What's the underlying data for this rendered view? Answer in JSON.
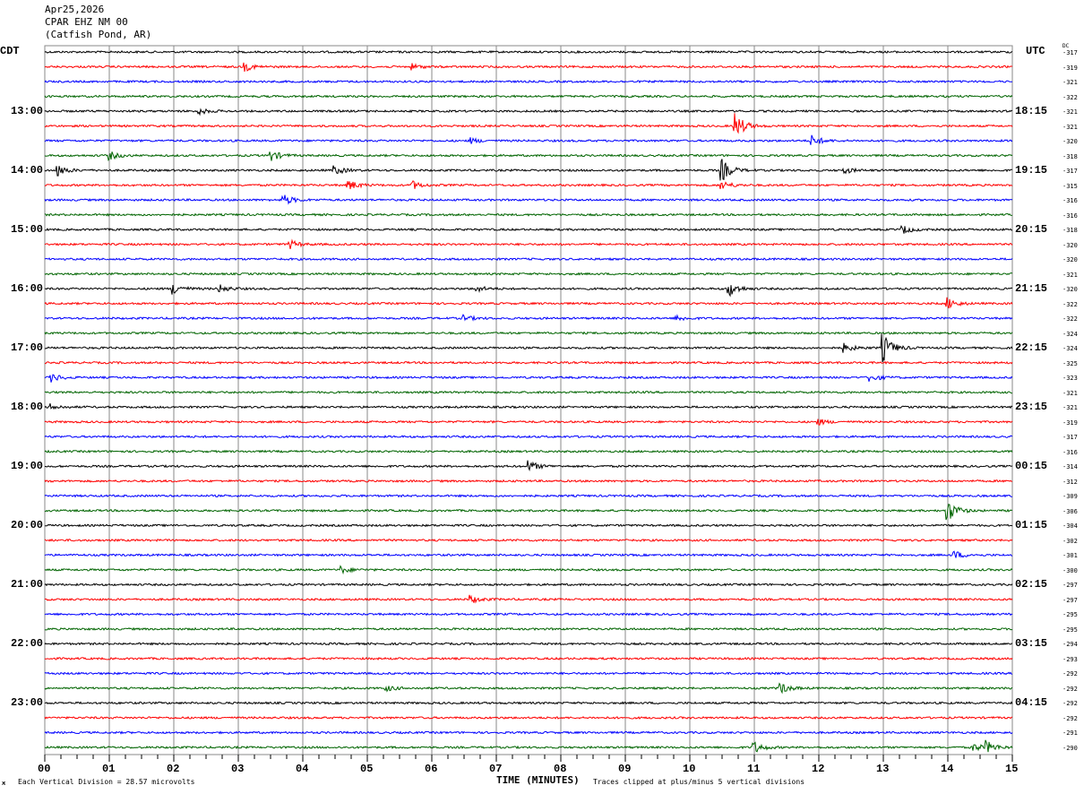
{
  "header": {
    "date": "Apr25,2026",
    "channel": "CPAR EHZ NM 00",
    "location": "(Catfish Pond, AR)"
  },
  "footer": {
    "scale_note": "Each Vertical Division =   28.57 microvolts",
    "xlabel": "TIME (MINUTES)",
    "clip_note": "Traces clipped at plus/minus 5 vertical divisions"
  },
  "chart_data": {
    "type": "line",
    "subtype": "helicorder",
    "xlabel": "TIME (MINUTES)",
    "xlim": [
      0,
      15
    ],
    "x_ticks": [
      "00",
      "01",
      "02",
      "03",
      "04",
      "05",
      "06",
      "07",
      "08",
      "09",
      "10",
      "11",
      "12",
      "13",
      "14",
      "15"
    ],
    "grid": "vertical lines each minute",
    "left_axis_title": "CDT",
    "right_axis_title": "UTC",
    "dc_title": "DC",
    "left_labels": [
      {
        "row": 4,
        "text": "13:00"
      },
      {
        "row": 8,
        "text": "14:00"
      },
      {
        "row": 12,
        "text": "15:00"
      },
      {
        "row": 16,
        "text": "16:00"
      },
      {
        "row": 20,
        "text": "17:00"
      },
      {
        "row": 24,
        "text": "18:00"
      },
      {
        "row": 28,
        "text": "19:00"
      },
      {
        "row": 32,
        "text": "20:00"
      },
      {
        "row": 36,
        "text": "21:00"
      },
      {
        "row": 40,
        "text": "22:00"
      },
      {
        "row": 44,
        "text": "23:00"
      }
    ],
    "right_labels": [
      {
        "row": 4,
        "text": "18:15"
      },
      {
        "row": 8,
        "text": "19:15"
      },
      {
        "row": 12,
        "text": "20:15"
      },
      {
        "row": 16,
        "text": "21:15"
      },
      {
        "row": 20,
        "text": "22:15"
      },
      {
        "row": 24,
        "text": "23:15"
      },
      {
        "row": 28,
        "text": "00:15"
      },
      {
        "row": 32,
        "text": "01:15"
      },
      {
        "row": 36,
        "text": "02:15"
      },
      {
        "row": 40,
        "text": "03:15"
      },
      {
        "row": 44,
        "text": "04:15"
      }
    ],
    "dc_offsets": [
      "-317",
      "-319",
      "-321",
      "-322",
      "-321",
      "-321",
      "-320",
      "-318",
      "-317",
      "-315",
      "-316",
      "-316",
      "-318",
      "-320",
      "-320",
      "-321",
      "-320",
      "-322",
      "-322",
      "-324",
      "-324",
      "-325",
      "-323",
      "-321",
      "-321",
      "-319",
      "-317",
      "-316",
      "-314",
      "-312",
      "-309",
      "-306",
      "-304",
      "-302",
      "-301",
      "-300",
      "-297",
      "-297",
      "-295",
      "-295",
      "-294",
      "-293",
      "-292",
      "-292",
      "-292",
      "-292",
      "-291",
      "-290"
    ],
    "trace_colors": [
      "#000000",
      "#ff0000",
      "#0000ff",
      "#006400"
    ],
    "clip_divisions": 5,
    "events": [
      {
        "row": 1,
        "minute": 3.1,
        "amp": 1.5
      },
      {
        "row": 1,
        "minute": 5.7,
        "amp": 1
      },
      {
        "row": 4,
        "minute": 2.4,
        "amp": 1
      },
      {
        "row": 5,
        "minute": 10.7,
        "amp": 5
      },
      {
        "row": 6,
        "minute": 11.9,
        "amp": 2
      },
      {
        "row": 6,
        "minute": 6.6,
        "amp": 1
      },
      {
        "row": 7,
        "minute": 1.0,
        "amp": 1.5
      },
      {
        "row": 7,
        "minute": 3.5,
        "amp": 2
      },
      {
        "row": 8,
        "minute": 0.2,
        "amp": 2
      },
      {
        "row": 8,
        "minute": 4.5,
        "amp": 1.5
      },
      {
        "row": 8,
        "minute": 10.5,
        "amp": 4
      },
      {
        "row": 8,
        "minute": 12.4,
        "amp": 1
      },
      {
        "row": 9,
        "minute": 4.7,
        "amp": 2
      },
      {
        "row": 9,
        "minute": 5.7,
        "amp": 1.5
      },
      {
        "row": 9,
        "minute": 10.5,
        "amp": 1.5
      },
      {
        "row": 10,
        "minute": 3.7,
        "amp": 2
      },
      {
        "row": 12,
        "minute": 13.3,
        "amp": 1.5
      },
      {
        "row": 13,
        "minute": 3.8,
        "amp": 1.5
      },
      {
        "row": 16,
        "minute": 2.0,
        "amp": 2
      },
      {
        "row": 16,
        "minute": 2.7,
        "amp": 1.5
      },
      {
        "row": 16,
        "minute": 6.7,
        "amp": 1
      },
      {
        "row": 16,
        "minute": 10.6,
        "amp": 3
      },
      {
        "row": 17,
        "minute": 14.0,
        "amp": 2
      },
      {
        "row": 18,
        "minute": 6.5,
        "amp": 1
      },
      {
        "row": 18,
        "minute": 9.8,
        "amp": 1
      },
      {
        "row": 20,
        "minute": 13.0,
        "amp": 5
      },
      {
        "row": 20,
        "minute": 12.4,
        "amp": 1.5
      },
      {
        "row": 22,
        "minute": 0.1,
        "amp": 1.5
      },
      {
        "row": 22,
        "minute": 12.8,
        "amp": 1.5
      },
      {
        "row": 24,
        "minute": 0.1,
        "amp": 1
      },
      {
        "row": 25,
        "minute": 12.0,
        "amp": 1
      },
      {
        "row": 28,
        "minute": 7.5,
        "amp": 2
      },
      {
        "row": 31,
        "minute": 14.0,
        "amp": 4
      },
      {
        "row": 34,
        "minute": 14.1,
        "amp": 1.5
      },
      {
        "row": 35,
        "minute": 4.6,
        "amp": 1.2
      },
      {
        "row": 37,
        "minute": 6.6,
        "amp": 1.5
      },
      {
        "row": 43,
        "minute": 5.3,
        "amp": 1
      },
      {
        "row": 43,
        "minute": 11.4,
        "amp": 2
      },
      {
        "row": 47,
        "minute": 11.0,
        "amp": 2
      },
      {
        "row": 47,
        "minute": 14.4,
        "amp": 1.5
      },
      {
        "row": 47,
        "minute": 14.6,
        "amp": 2
      }
    ]
  }
}
